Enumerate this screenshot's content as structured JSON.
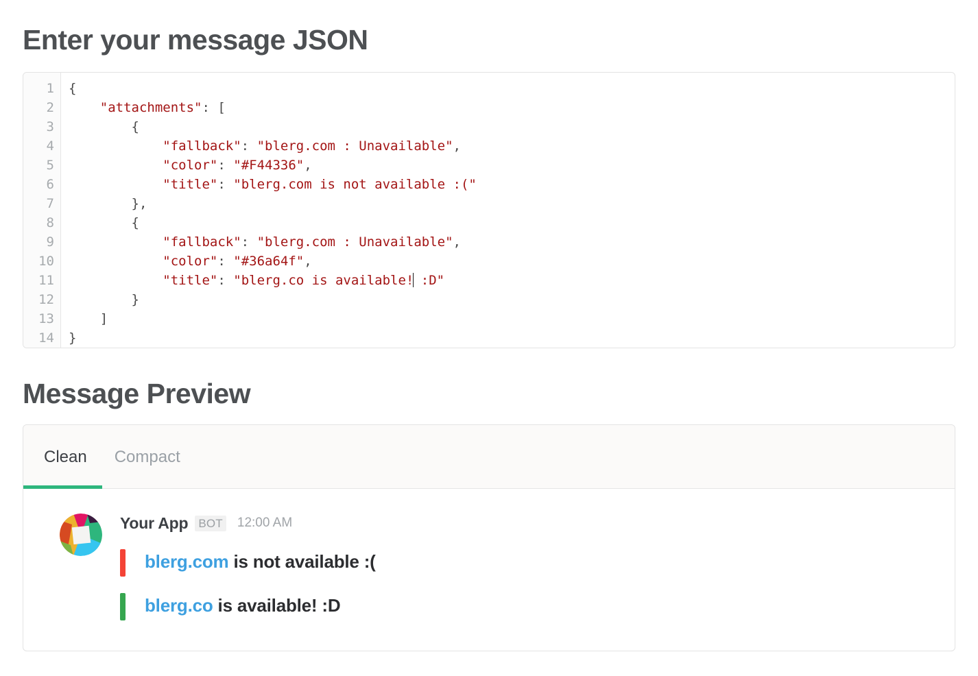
{
  "headings": {
    "json": "Enter your message JSON",
    "preview": "Message Preview"
  },
  "editor": {
    "line_numbers": [
      "1",
      "2",
      "3",
      "4",
      "5",
      "6",
      "7",
      "8",
      "9",
      "10",
      "11",
      "12",
      "13",
      "14"
    ],
    "lines": [
      {
        "indent": "",
        "content": "{",
        "type": "punct"
      },
      {
        "indent": "    ",
        "key": "\"attachments\"",
        "sep": ": ",
        "value": "[",
        "type": "key-punct"
      },
      {
        "indent": "        ",
        "content": "{",
        "type": "punct"
      },
      {
        "indent": "            ",
        "key": "\"fallback\"",
        "sep": ": ",
        "value": "\"blerg.com : Unavailable\"",
        "trail": ",",
        "type": "key-string"
      },
      {
        "indent": "            ",
        "key": "\"color\"",
        "sep": ": ",
        "value": "\"#F44336\"",
        "trail": ",",
        "type": "key-string"
      },
      {
        "indent": "            ",
        "key": "\"title\"",
        "sep": ": ",
        "value": "\"blerg.com is not available :(\"",
        "trail": "",
        "type": "key-string"
      },
      {
        "indent": "        ",
        "content": "},",
        "type": "punct"
      },
      {
        "indent": "        ",
        "content": "{",
        "type": "punct"
      },
      {
        "indent": "            ",
        "key": "\"fallback\"",
        "sep": ": ",
        "value": "\"blerg.com : Unavailable\"",
        "trail": ",",
        "type": "key-string"
      },
      {
        "indent": "            ",
        "key": "\"color\"",
        "sep": ": ",
        "value": "\"#36a64f\"",
        "trail": ",",
        "type": "key-string"
      },
      {
        "indent": "            ",
        "key": "\"title\"",
        "sep": ": ",
        "value": "\"blerg.co is available!",
        "caret": true,
        "value2": " :D\"",
        "trail": "",
        "type": "key-string-caret"
      },
      {
        "indent": "        ",
        "content": "}",
        "type": "punct"
      },
      {
        "indent": "    ",
        "content": "]",
        "type": "punct"
      },
      {
        "indent": "",
        "content": "}",
        "type": "punct"
      }
    ],
    "raw_text": "{\n    \"attachments\": [\n        {\n            \"fallback\": \"blerg.com : Unavailable\",\n            \"color\": \"#F44336\",\n            \"title\": \"blerg.com is not available :(\"\n        },\n        {\n            \"fallback\": \"blerg.com : Unavailable\",\n            \"color\": \"#36a64f\",\n            \"title\": \"blerg.co is available! :D\"\n        }\n    ]\n}"
  },
  "preview": {
    "tabs": [
      {
        "label": "Clean",
        "active": true
      },
      {
        "label": "Compact",
        "active": false
      }
    ],
    "message": {
      "app_name": "Your App",
      "bot_badge": "BOT",
      "timestamp": "12:00 AM",
      "attachments": [
        {
          "color": "#F44336",
          "link_text": "blerg.com",
          "rest_text": " is not available :("
        },
        {
          "color": "#36a64f",
          "link_text": "blerg.co",
          "rest_text": " is available! :D"
        }
      ]
    }
  },
  "colors": {
    "accent_green": "#2eb67d",
    "link_blue": "#3ea0e0",
    "heading_gray": "#4d5053",
    "code_string_red": "#a31515",
    "border_gray": "#e3e3e3"
  },
  "avatar": {
    "name": "slack-logo",
    "segments": [
      "#e01563",
      "#2eb67d",
      "#ecb22e",
      "#36c5f0",
      "#3b1b40",
      "#d64a21"
    ]
  }
}
